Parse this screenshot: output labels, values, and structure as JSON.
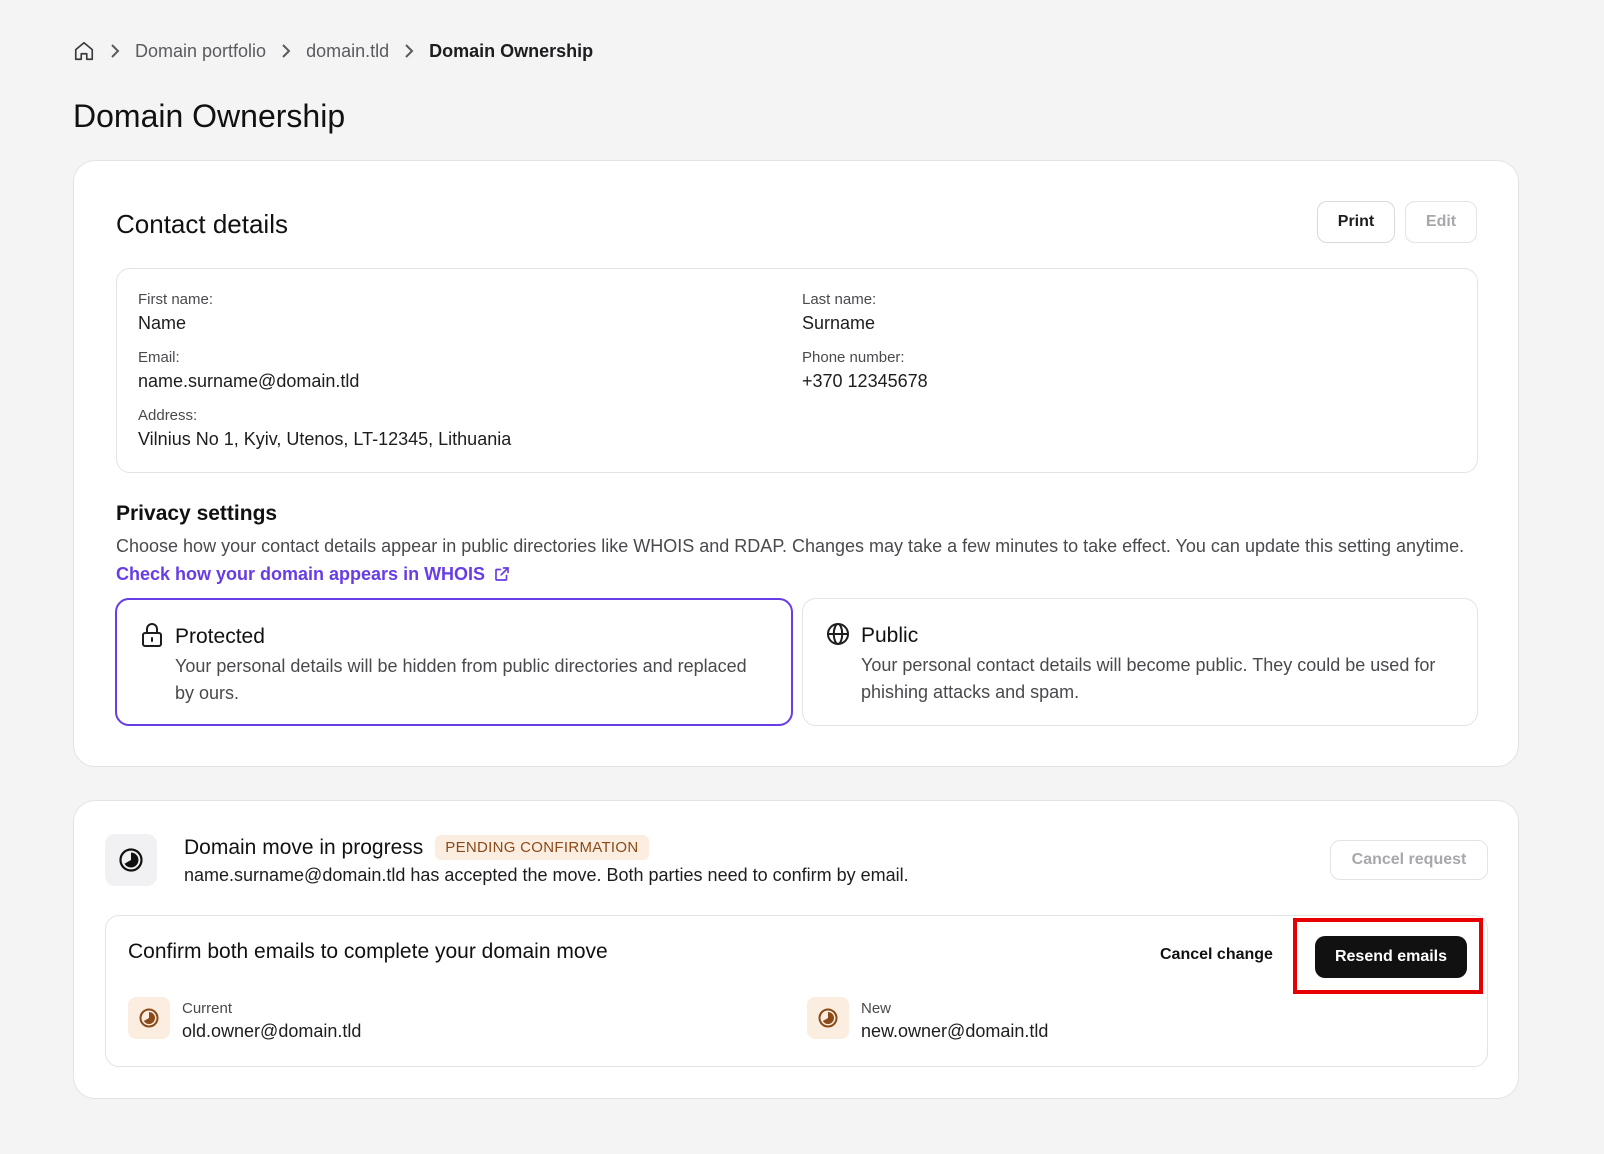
{
  "breadcrumb": {
    "home_icon": "home-icon",
    "items": [
      "Domain portfolio",
      "domain.tld",
      "Domain Ownership"
    ]
  },
  "page_title": "Domain Ownership",
  "contact": {
    "title": "Contact details",
    "print_label": "Print",
    "edit_label": "Edit",
    "fields": {
      "first_name_label": "First name:",
      "first_name": "Name",
      "last_name_label": "Last name:",
      "last_name": "Surname",
      "email_label": "Email:",
      "email": "name.surname@domain.tld",
      "phone_label": "Phone number:",
      "phone": "+370 12345678",
      "address_label": "Address:",
      "address": "Vilnius No 1, Kyiv, Utenos, LT-12345, Lithuania"
    }
  },
  "privacy": {
    "title": "Privacy settings",
    "description": "Choose how your contact details appear in public directories like WHOIS and RDAP. Changes may take a few minutes to take effect. You can update this setting anytime.",
    "link_label": "Check how your domain appears in WHOIS",
    "options": [
      {
        "icon": "lock-icon",
        "title": "Protected",
        "description": "Your personal details will be hidden from public directories and replaced by ours.",
        "selected": true
      },
      {
        "icon": "globe-icon",
        "title": "Public",
        "description": "Your personal contact details will become public. They could be used for phishing attacks and spam.",
        "selected": false
      }
    ]
  },
  "move": {
    "icon": "progress-icon",
    "title": "Domain move in progress",
    "badge": "PENDING CONFIRMATION",
    "description": "name.surname@domain.tld has accepted the move. Both parties need to confirm by email.",
    "cancel_request_label": "Cancel request",
    "confirm": {
      "title": "Confirm both emails to complete your domain move",
      "cancel_change_label": "Cancel change",
      "resend_label": "Resend emails",
      "current_label": "Current",
      "current_email": "old.owner@domain.tld",
      "new_label": "New",
      "new_email": "new.owner@domain.tld"
    }
  },
  "colors": {
    "accent": "#673de6",
    "badge_bg": "#fbeee0",
    "badge_text": "#8a4a1a",
    "highlight": "#e60000"
  }
}
